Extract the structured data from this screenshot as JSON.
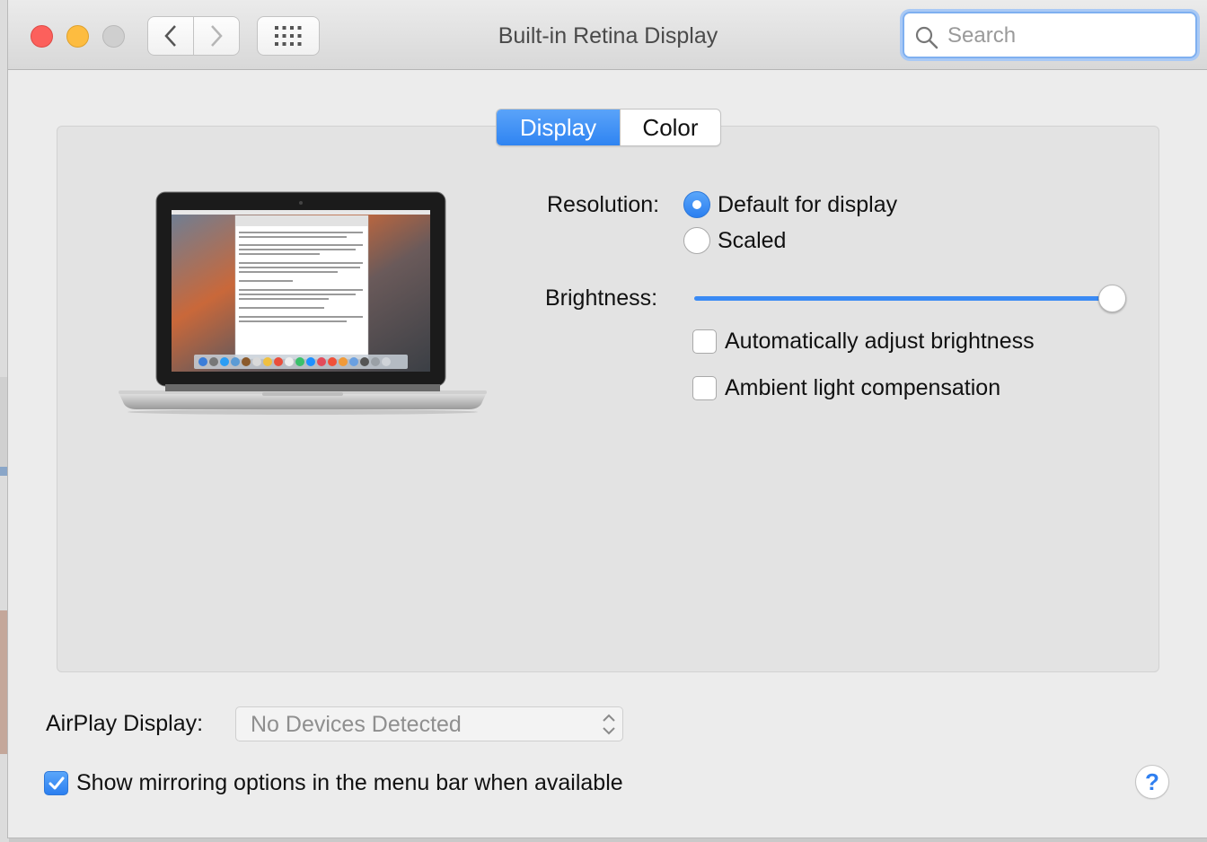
{
  "window": {
    "title": "Built-in Retina Display"
  },
  "search": {
    "placeholder": "Search"
  },
  "tabs": [
    {
      "label": "Display",
      "active": true
    },
    {
      "label": "Color",
      "active": false
    }
  ],
  "resolution": {
    "label": "Resolution:",
    "options": [
      {
        "label": "Default for display",
        "selected": true
      },
      {
        "label": "Scaled",
        "selected": false
      }
    ]
  },
  "brightness": {
    "label": "Brightness:",
    "level": 1.0,
    "auto_adjust": {
      "label": "Automatically adjust brightness",
      "checked": false
    },
    "ambient": {
      "label": "Ambient light compensation",
      "checked": false
    }
  },
  "airplay": {
    "label": "AirPlay Display:",
    "selected": "No Devices Detected"
  },
  "mirroring": {
    "label": "Show mirroring options in the menu bar when available",
    "checked": true
  },
  "help": {
    "label": "?"
  },
  "colors": {
    "accent": "#2f84f2",
    "close": "#fc605c",
    "minimize": "#fdbc40"
  }
}
